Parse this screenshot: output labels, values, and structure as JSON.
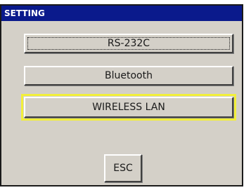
{
  "window": {
    "title": "SETTING"
  },
  "buttons": {
    "rs232c_label": "RS-232C",
    "bluetooth_label": "Bluetooth",
    "wireless_lan_label": "WIRELESS LAN",
    "esc_label": "ESC"
  },
  "colors": {
    "titlebar": "#0a1a8c",
    "highlight": "#f2ef3a",
    "panel": "#d4d0c8"
  }
}
